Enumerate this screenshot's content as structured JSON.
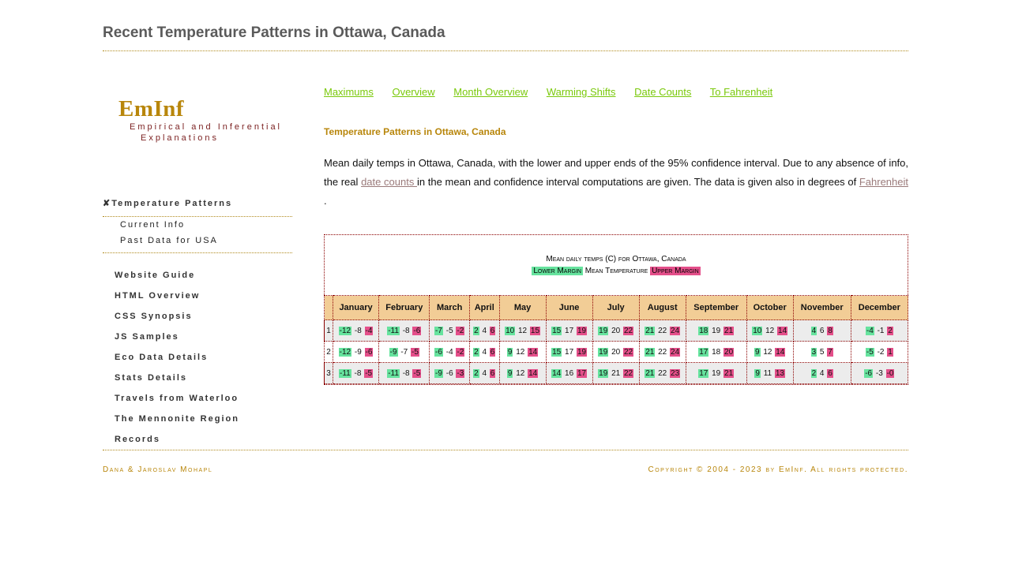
{
  "page": {
    "title": "Recent Temperature Patterns in Ottawa, Canada"
  },
  "logo": {
    "name": "EmInf",
    "tagline1": "Empirical and Inferential",
    "tagline2": "Explanations"
  },
  "sidebar": {
    "section": "✘Temperature Patterns",
    "subitems": [
      "Current Info",
      "Past Data for USA"
    ],
    "items": [
      "Website Guide",
      "HTML Overview",
      "CSS Synopsis",
      "JS Samples",
      "Eco Data Details",
      "Stats Details",
      "Travels from Waterloo",
      "The Mennonite Region",
      "Records"
    ]
  },
  "topnav": [
    "Maximums",
    "Overview",
    "Month Overview",
    "Warming Shifts",
    "Date Counts",
    "To Fahrenheit"
  ],
  "content": {
    "heading": "Temperature Patterns in Ottawa, Canada",
    "p1": "Mean daily temps in Ottawa, Canada, with the lower and upper ends of the 95% confidence interval. Due to any absence of info, the real ",
    "link1": "date counts ",
    "p2": "in the mean and confidence interval computations are given. The data is given also in degrees of ",
    "link2": "Fahrenheit ",
    "p3": "."
  },
  "table": {
    "caption": "Mean daily temps (C) for Ottawa, Canada",
    "legend_low": "Lower Margin",
    "legend_mean": "Mean Temperature",
    "legend_high": "Upper Margin",
    "months": [
      "January",
      "February",
      "March",
      "April",
      "May",
      "June",
      "July",
      "August",
      "September",
      "October",
      "November",
      "December"
    ],
    "rows": [
      {
        "idx": "1",
        "cells": [
          [
            "-12",
            "-8",
            "-4"
          ],
          [
            "-11",
            "-8",
            "-6"
          ],
          [
            "-7",
            "-5",
            "-2"
          ],
          [
            "2",
            "4",
            "6"
          ],
          [
            "10",
            "12",
            "15"
          ],
          [
            "15",
            "17",
            "19"
          ],
          [
            "19",
            "20",
            "22"
          ],
          [
            "21",
            "22",
            "24"
          ],
          [
            "18",
            "19",
            "21"
          ],
          [
            "10",
            "12",
            "14"
          ],
          [
            "4",
            "6",
            "8"
          ],
          [
            "-4",
            "-1",
            "2"
          ]
        ]
      },
      {
        "idx": "2",
        "cells": [
          [
            "-12",
            "-9",
            "-6"
          ],
          [
            "-9",
            "-7",
            "-5"
          ],
          [
            "-6",
            "-4",
            "-2"
          ],
          [
            "2",
            "4",
            "6"
          ],
          [
            "9",
            "12",
            "14"
          ],
          [
            "15",
            "17",
            "19"
          ],
          [
            "19",
            "20",
            "22"
          ],
          [
            "21",
            "22",
            "24"
          ],
          [
            "17",
            "18",
            "20"
          ],
          [
            "9",
            "12",
            "14"
          ],
          [
            "3",
            "5",
            "7"
          ],
          [
            "-5",
            "-2",
            "1"
          ]
        ]
      },
      {
        "idx": "3",
        "cells": [
          [
            "-11",
            "-8",
            "-5"
          ],
          [
            "-11",
            "-8",
            "-5"
          ],
          [
            "-9",
            "-6",
            "-3"
          ],
          [
            "2",
            "4",
            "6"
          ],
          [
            "9",
            "12",
            "14"
          ],
          [
            "14",
            "16",
            "17"
          ],
          [
            "19",
            "21",
            "22"
          ],
          [
            "21",
            "22",
            "23"
          ],
          [
            "17",
            "19",
            "21"
          ],
          [
            "9",
            "11",
            "13"
          ],
          [
            "2",
            "4",
            "6"
          ],
          [
            "-6",
            "-3",
            "-0"
          ]
        ]
      }
    ],
    "colors": {
      "low": "#66e39e",
      "high": "#e44f8a",
      "header": "#f2cd96"
    }
  },
  "footer": {
    "left": "Dana & Jaroslav Mohapl",
    "right": "Copyright © 2004 - 2023 by EmInf. All rights protected."
  }
}
